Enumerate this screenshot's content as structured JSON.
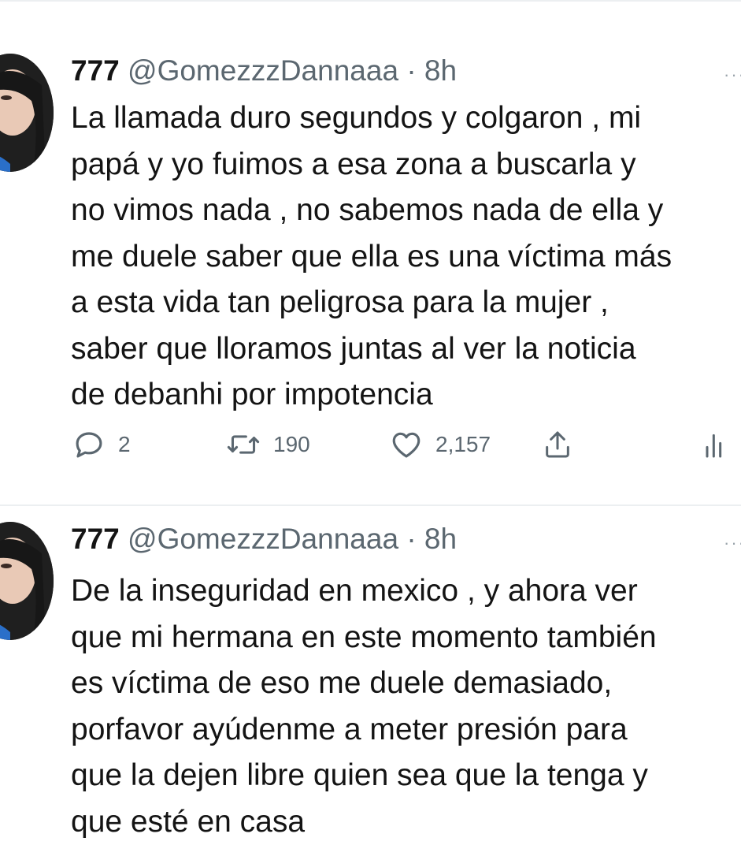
{
  "tweets": [
    {
      "author_name": "777",
      "handle": "@GomezzzDannaaa",
      "separator": "·",
      "time": "8h",
      "more": "···",
      "text": "La llamada duro segundos y colgaron , mi\npapá y yo fuimos a esa zona a buscarla y\nno vimos nada , no sabemos nada de ella y\nme duele saber que ella es una víctima más\na esta vida tan peligrosa para la mujer ,\nsaber que lloramos juntas al ver la noticia\nde debanhi por impotencia",
      "replies": "2",
      "retweets": "190",
      "likes": "2,157",
      "icons": [
        "reply-icon",
        "retweet-icon",
        "like-icon",
        "share-icon",
        "analytics-icon"
      ]
    },
    {
      "author_name": "777",
      "handle": "@GomezzzDannaaa",
      "separator": "·",
      "time": "8h",
      "more": "···",
      "text": "De la inseguridad en mexico , y ahora ver\nque mi hermana en este momento también\nes víctima de eso me duele demasiado,\nporfavor ayúdenme a meter presión para\nque la dejen libre quien sea que la tenga y\nque esté en casa"
    }
  ],
  "colors": {
    "text": "#141414",
    "muted": "#5b6770",
    "background": "#ffffff"
  }
}
